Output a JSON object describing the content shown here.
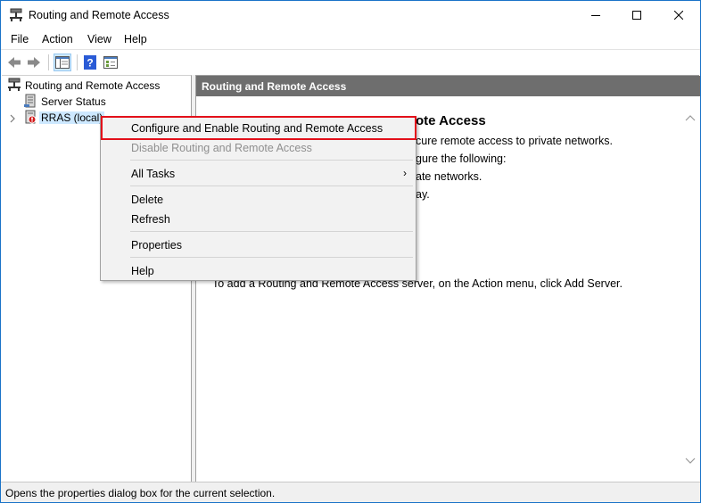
{
  "window": {
    "title": "Routing and Remote Access"
  },
  "menubar": {
    "file": "File",
    "action": "Action",
    "view": "View",
    "help": "Help"
  },
  "toolbar": {
    "icons": [
      "back-arrow-icon",
      "forward-arrow-icon",
      "show-hide-tree-icon",
      "help-icon",
      "properties-icon"
    ]
  },
  "tree": {
    "root_label": "Routing and Remote Access",
    "items": [
      {
        "label": "Server Status"
      },
      {
        "label": "RRAS (local)"
      }
    ]
  },
  "right_pane": {
    "header": "Routing and Remote Access",
    "heading_visible": "ote Access",
    "lines": [
      "cure remote access to private networks.",
      "gure the following:",
      "ate networks.",
      "ay.",
      "To add a Routing and Remote Access server, on the Action menu, click Add Server."
    ]
  },
  "context_menu": {
    "configure": "Configure and Enable Routing and Remote Access",
    "disable": "Disable Routing and Remote Access",
    "all_tasks": "All Tasks",
    "submenu_arrow": "›",
    "delete": "Delete",
    "refresh": "Refresh",
    "properties": "Properties",
    "help": "Help"
  },
  "statusbar": {
    "text": "Opens the properties dialog box for the current selection."
  },
  "colors": {
    "window_border": "#1a73c8",
    "header_bg": "#6e6e6e",
    "highlight": "#e3101a",
    "selection": "#cde8ff"
  }
}
